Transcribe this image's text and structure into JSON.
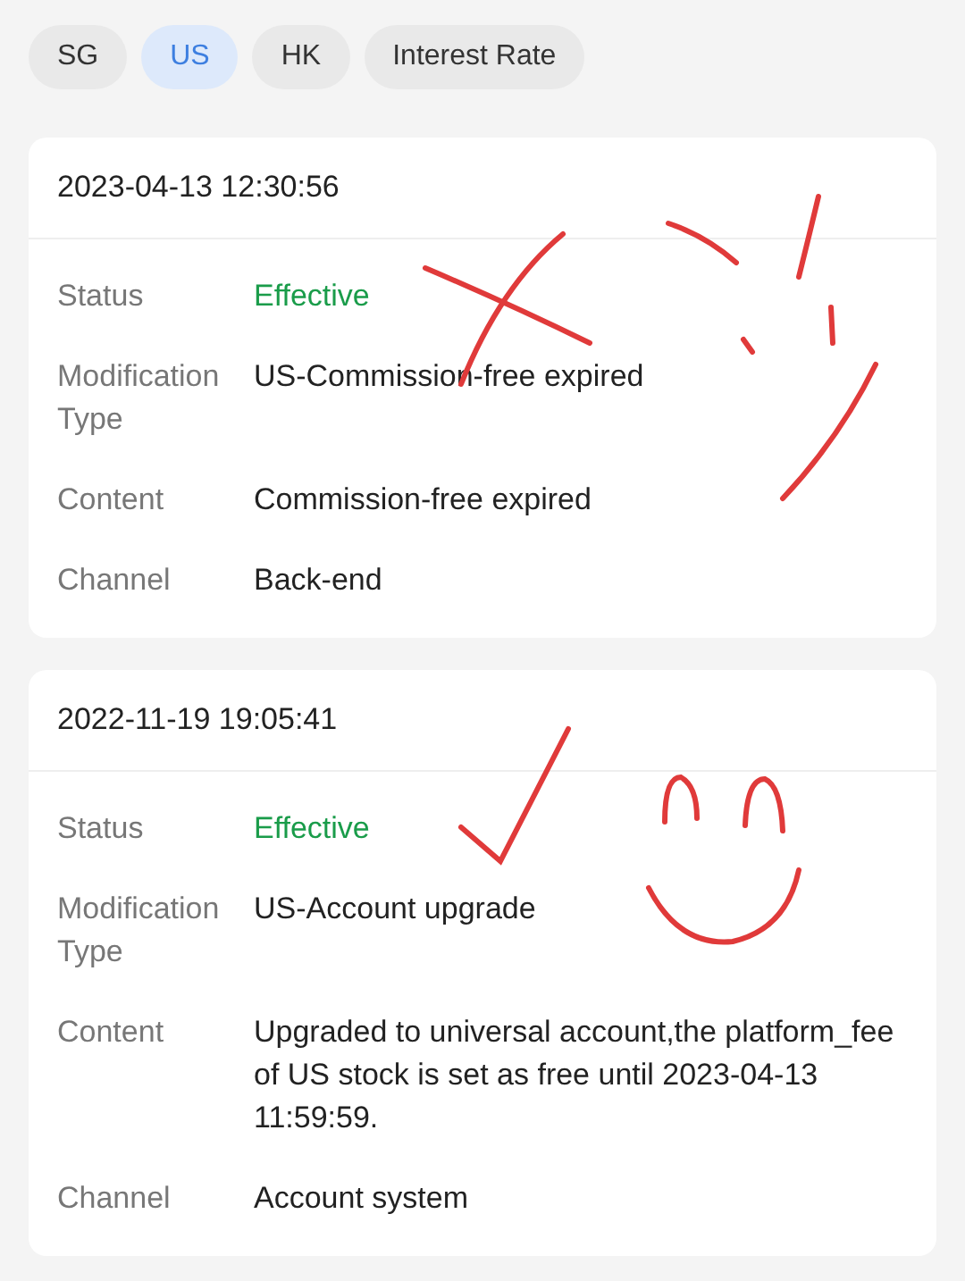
{
  "tabs": [
    {
      "label": "SG",
      "selected": false
    },
    {
      "label": "US",
      "selected": true
    },
    {
      "label": "HK",
      "selected": false
    },
    {
      "label": "Interest Rate",
      "selected": false
    }
  ],
  "records": [
    {
      "datetime": "2023-04-13 12:30:56",
      "fields": [
        {
          "label": "Status",
          "value": "Effective",
          "kind": "status"
        },
        {
          "label": "Modification Type",
          "value": "US-Commission-free expired",
          "kind": "text"
        },
        {
          "label": "Content",
          "value": "Commission-free expired",
          "kind": "text"
        },
        {
          "label": "Channel",
          "value": "Back-end",
          "kind": "text"
        }
      ]
    },
    {
      "datetime": "2022-11-19 19:05:41",
      "fields": [
        {
          "label": "Status",
          "value": "Effective",
          "kind": "status"
        },
        {
          "label": "Modification Type",
          "value": "US-Account upgrade",
          "kind": "text"
        },
        {
          "label": "Content",
          "value": "Upgraded to universal account,the platform_fee of US stock is set as free until 2023-04-13 11:59:59.",
          "kind": "text"
        },
        {
          "label": "Channel",
          "value": "Account system",
          "kind": "text"
        }
      ]
    }
  ]
}
